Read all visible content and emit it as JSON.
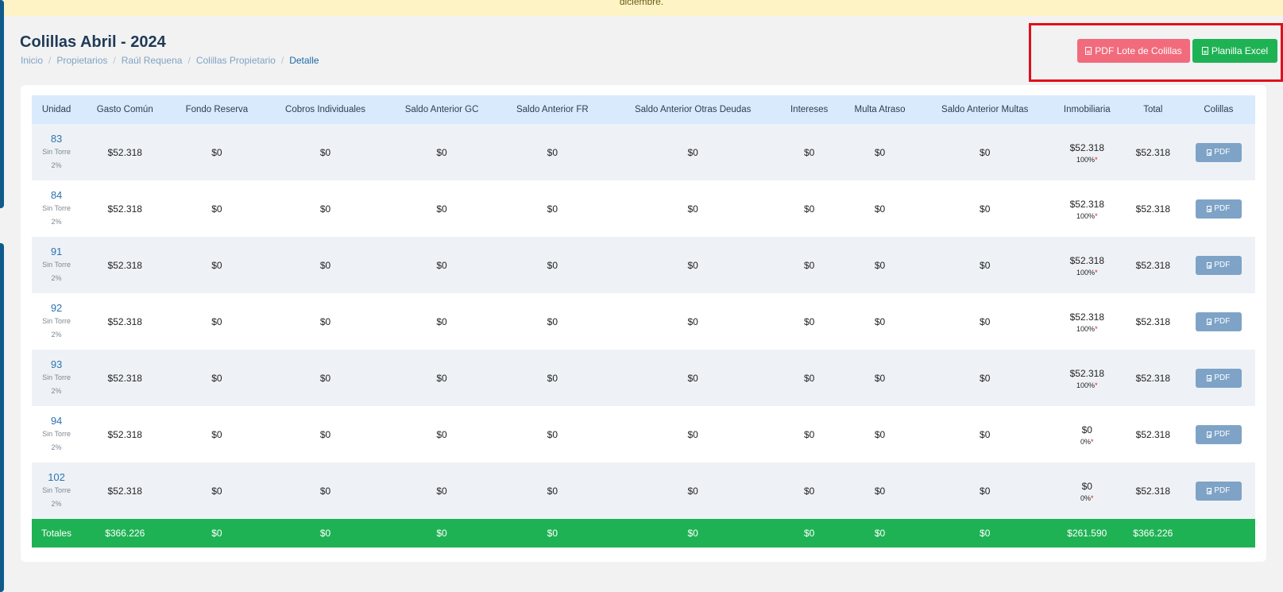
{
  "notice": {
    "text": "diciembre."
  },
  "page": {
    "title": "Colillas Abril - 2024",
    "breadcrumb": [
      "Inicio",
      "Propietarios",
      "Raúl Requena",
      "Colillas Propietario",
      "Detalle"
    ]
  },
  "actions": {
    "pdf_lote_label": "PDF Lote de Colillas",
    "excel_label": "Planilla Excel",
    "pdf_lote_color": "#f26b7c",
    "excel_color": "#1fb254",
    "highlight_color": "#e0101b"
  },
  "table": {
    "headers": [
      "Unidad",
      "Gasto Común",
      "Fondo Reserva",
      "Cobros Individuales",
      "Saldo Anterior GC",
      "Saldo Anterior FR",
      "Saldo Anterior Otras Deudas",
      "Intereses",
      "Multa Atraso",
      "Saldo Anterior Multas",
      "Inmobiliaria",
      "Total",
      "Colillas"
    ],
    "rows": [
      {
        "unit": "83",
        "torre": "Sin Torre",
        "pct": "2%",
        "gasto": "$52.318",
        "fondo": "$0",
        "cobros": "$0",
        "sgc": "$0",
        "sfr": "$0",
        "sotras": "$0",
        "intereses": "$0",
        "multa": "$0",
        "smultas": "$0",
        "inmo": "$52.318",
        "inmo_pct": "100%",
        "total": "$52.318",
        "pdf": "PDF"
      },
      {
        "unit": "84",
        "torre": "Sin Torre",
        "pct": "2%",
        "gasto": "$52.318",
        "fondo": "$0",
        "cobros": "$0",
        "sgc": "$0",
        "sfr": "$0",
        "sotras": "$0",
        "intereses": "$0",
        "multa": "$0",
        "smultas": "$0",
        "inmo": "$52.318",
        "inmo_pct": "100%",
        "total": "$52.318",
        "pdf": "PDF"
      },
      {
        "unit": "91",
        "torre": "Sin Torre",
        "pct": "2%",
        "gasto": "$52.318",
        "fondo": "$0",
        "cobros": "$0",
        "sgc": "$0",
        "sfr": "$0",
        "sotras": "$0",
        "intereses": "$0",
        "multa": "$0",
        "smultas": "$0",
        "inmo": "$52.318",
        "inmo_pct": "100%",
        "total": "$52.318",
        "pdf": "PDF"
      },
      {
        "unit": "92",
        "torre": "Sin Torre",
        "pct": "2%",
        "gasto": "$52.318",
        "fondo": "$0",
        "cobros": "$0",
        "sgc": "$0",
        "sfr": "$0",
        "sotras": "$0",
        "intereses": "$0",
        "multa": "$0",
        "smultas": "$0",
        "inmo": "$52.318",
        "inmo_pct": "100%",
        "total": "$52.318",
        "pdf": "PDF"
      },
      {
        "unit": "93",
        "torre": "Sin Torre",
        "pct": "2%",
        "gasto": "$52.318",
        "fondo": "$0",
        "cobros": "$0",
        "sgc": "$0",
        "sfr": "$0",
        "sotras": "$0",
        "intereses": "$0",
        "multa": "$0",
        "smultas": "$0",
        "inmo": "$52.318",
        "inmo_pct": "100%",
        "total": "$52.318",
        "pdf": "PDF"
      },
      {
        "unit": "94",
        "torre": "Sin Torre",
        "pct": "2%",
        "gasto": "$52.318",
        "fondo": "$0",
        "cobros": "$0",
        "sgc": "$0",
        "sfr": "$0",
        "sotras": "$0",
        "intereses": "$0",
        "multa": "$0",
        "smultas": "$0",
        "inmo": "$0",
        "inmo_pct": "0%",
        "total": "$52.318",
        "pdf": "PDF"
      },
      {
        "unit": "102",
        "torre": "Sin Torre",
        "pct": "2%",
        "gasto": "$52.318",
        "fondo": "$0",
        "cobros": "$0",
        "sgc": "$0",
        "sfr": "$0",
        "sotras": "$0",
        "intereses": "$0",
        "multa": "$0",
        "smultas": "$0",
        "inmo": "$0",
        "inmo_pct": "0%",
        "total": "$52.318",
        "pdf": "PDF"
      }
    ],
    "star": "*",
    "totals": [
      "Totales",
      "$366.226",
      "$0",
      "$0",
      "$0",
      "$0",
      "$0",
      "$0",
      "$0",
      "$0",
      "$261.590",
      "$366.226",
      ""
    ]
  }
}
